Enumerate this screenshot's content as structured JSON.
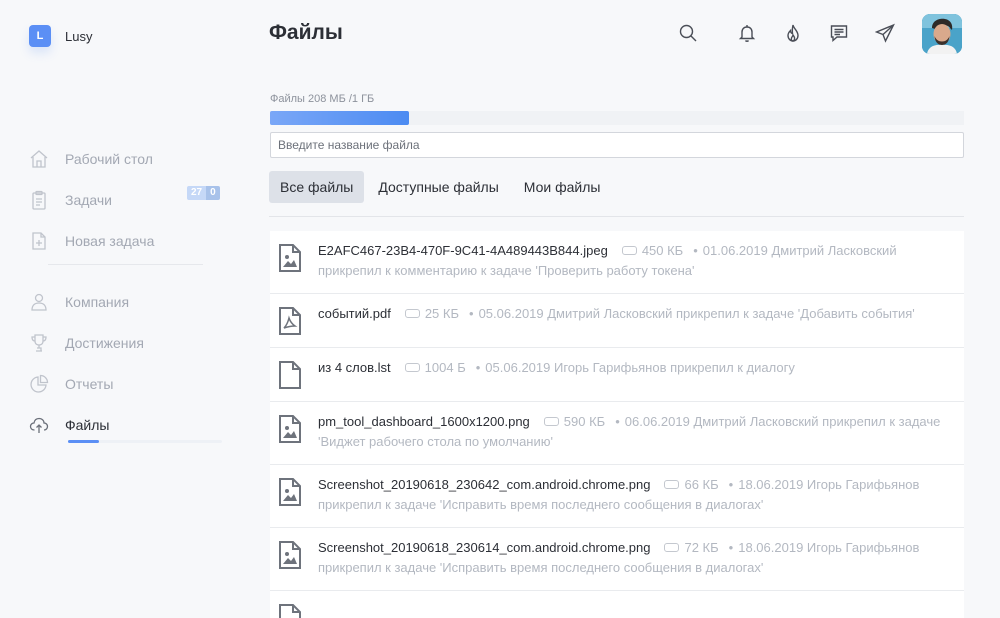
{
  "brand": {
    "initial": "L",
    "name": "Lusy"
  },
  "page_title": "Файлы",
  "sidebar": {
    "items": [
      {
        "label": "Рабочий стол",
        "icon": "home-icon"
      },
      {
        "label": "Задачи",
        "icon": "clipboard-icon",
        "badge_count": "27",
        "badge_new": "0"
      },
      {
        "label": "Новая задача",
        "icon": "new-task-icon"
      },
      {
        "label": "Компания",
        "icon": "users-icon"
      },
      {
        "label": "Достижения",
        "icon": "trophy-icon"
      },
      {
        "label": "Отчеты",
        "icon": "pie-chart-icon"
      },
      {
        "label": "Файлы",
        "icon": "cloud-icon",
        "active": true
      }
    ]
  },
  "header": {
    "icons": [
      "search-icon",
      "bell-icon",
      "fire-icon",
      "chat-icon",
      "send-icon"
    ]
  },
  "storage": {
    "label": "Файлы 208 МБ /1 ГБ",
    "used_fraction": 0.2
  },
  "search": {
    "placeholder": "Введите название файла",
    "value": ""
  },
  "tabs": [
    {
      "label": "Все файлы",
      "active": true
    },
    {
      "label": "Доступные файлы"
    },
    {
      "label": "Мои файлы"
    }
  ],
  "files": [
    {
      "name": "E2AFC467-23B4-470F-9C41-4A489443B844.jpeg",
      "size": "450 КБ",
      "description": "01.06.2019 Дмитрий Ласковский прикрепил к комментарию к задаче 'Проверить работу токена'",
      "icon": "image-file-icon"
    },
    {
      "name": "событий.pdf",
      "size": "25 КБ",
      "description": "05.06.2019 Дмитрий Ласковский прикрепил к задаче 'Добавить события'",
      "icon": "pdf-file-icon"
    },
    {
      "name": "из 4 слов.lst",
      "size": "1004 Б",
      "description": "05.06.2019 Игорь Гарифьянов прикрепил к диалогу",
      "icon": "document-file-icon"
    },
    {
      "name": "pm_tool_dashboard_1600x1200.png",
      "size": "590 КБ",
      "description": "06.06.2019 Дмитрий Ласковский прикрепил к задаче 'Виджет рабочего стола по умолчанию'",
      "icon": "image-file-icon"
    },
    {
      "name": "Screenshot_20190618_230642_com.android.chrome.png",
      "size": "66 КБ",
      "description": "18.06.2019 Игорь Гарифьянов прикрепил к задаче 'Исправить время последнего сообщения в диалогах'",
      "icon": "image-file-icon"
    },
    {
      "name": "Screenshot_20190618_230614_com.android.chrome.png",
      "size": "72 КБ",
      "description": "18.06.2019 Игорь Гарифьянов прикрепил к задаче 'Исправить время последнего сообщения в диалогах'",
      "icon": "image-file-icon"
    },
    {
      "name": "",
      "size": "",
      "description": "",
      "icon": "image-file-icon"
    }
  ]
}
